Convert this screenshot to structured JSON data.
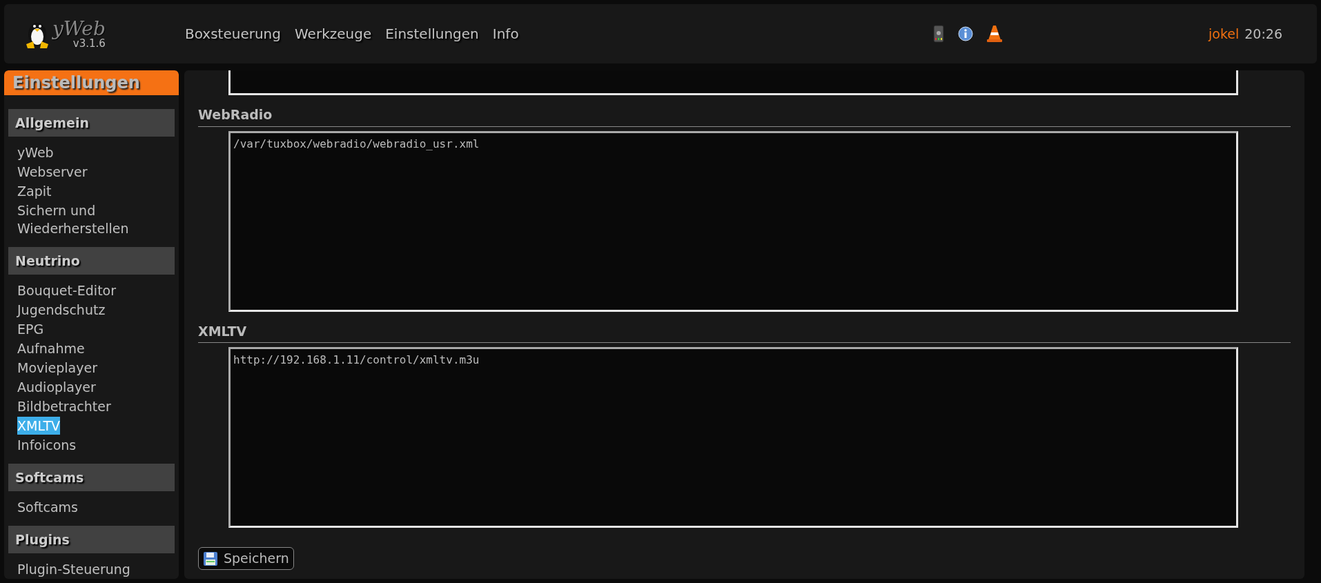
{
  "header": {
    "logo": {
      "name": "yWeb",
      "version": "v3.1.6"
    },
    "nav": [
      "Boxsteuerung",
      "Werkzeuge",
      "Einstellungen",
      "Info"
    ],
    "user": "jokel",
    "time": "20:26"
  },
  "sidebar": {
    "title": "Einstellungen",
    "groups": [
      {
        "title": "Allgemein",
        "items": [
          {
            "label": "yWeb",
            "selected": false
          },
          {
            "label": "Webserver",
            "selected": false
          },
          {
            "label": "Zapit",
            "selected": false
          },
          {
            "label": "Sichern und Wiederherstellen",
            "selected": false
          }
        ]
      },
      {
        "title": "Neutrino",
        "items": [
          {
            "label": "Bouquet-Editor",
            "selected": false
          },
          {
            "label": "Jugendschutz",
            "selected": false
          },
          {
            "label": "EPG",
            "selected": false
          },
          {
            "label": "Aufnahme",
            "selected": false
          },
          {
            "label": "Movieplayer",
            "selected": false
          },
          {
            "label": "Audioplayer",
            "selected": false
          },
          {
            "label": "Bildbetrachter",
            "selected": false
          },
          {
            "label": "XMLTV",
            "selected": true
          },
          {
            "label": "Infoicons",
            "selected": false
          }
        ]
      },
      {
        "title": "Softcams",
        "items": [
          {
            "label": "Softcams",
            "selected": false
          }
        ]
      },
      {
        "title": "Plugins",
        "items": [
          {
            "label": "Plugin-Steuerung",
            "selected": false
          }
        ]
      }
    ]
  },
  "main": {
    "sections": [
      {
        "title": "WebRadio",
        "value": "/var/tuxbox/webradio/webradio_usr.xml"
      },
      {
        "title": "XMLTV",
        "value": "http://192.168.1.11/control/xmltv.m3u"
      }
    ],
    "save_button": "Speichern"
  }
}
